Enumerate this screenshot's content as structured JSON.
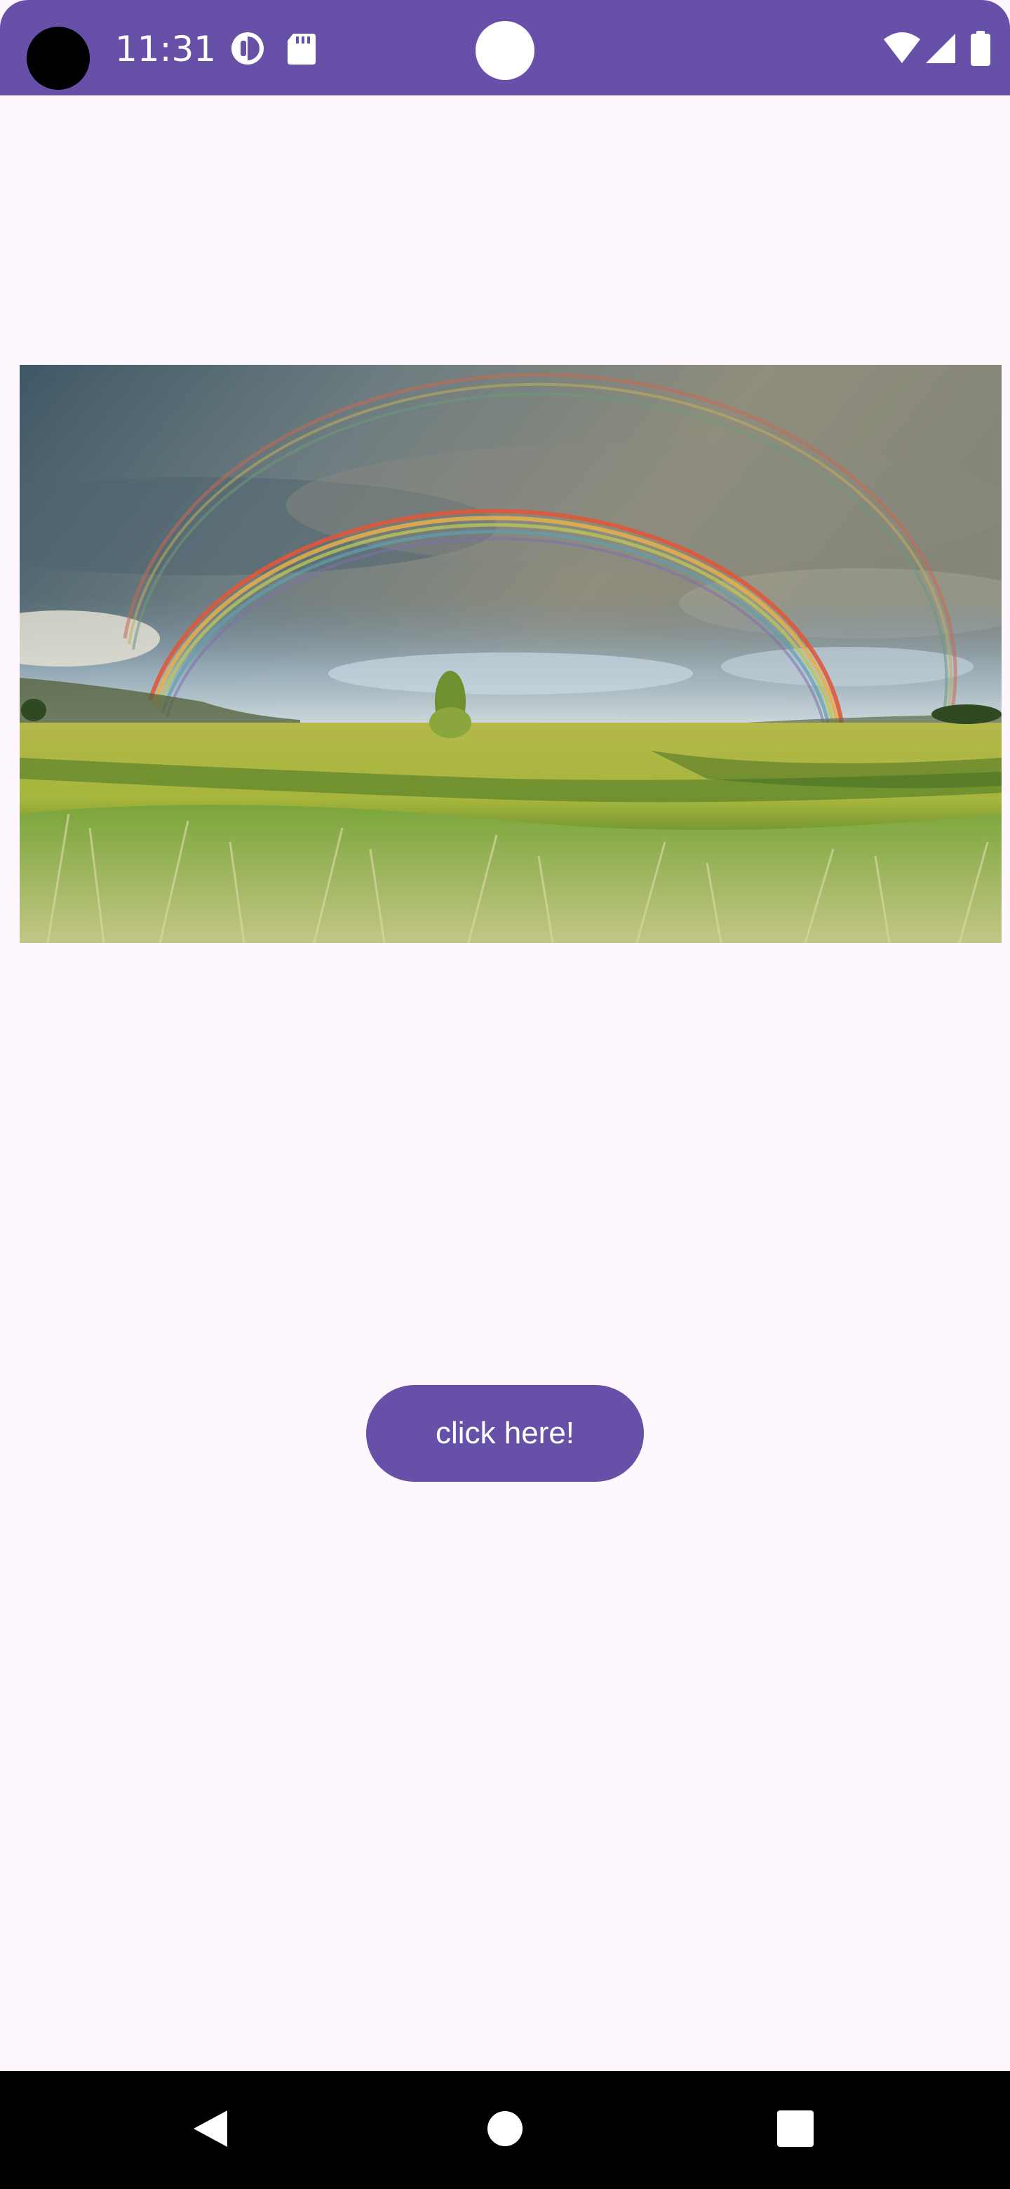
{
  "status_bar": {
    "time": "11:31",
    "left_icons": [
      "privacy-indicator-icon",
      "sd-card-icon"
    ],
    "right_icons": [
      "wifi-icon",
      "cell-signal-icon",
      "battery-icon"
    ]
  },
  "main": {
    "image": {
      "icon": "rainbow-landscape-image"
    },
    "button": {
      "label": "click here!"
    }
  },
  "nav_bar": {
    "buttons": [
      "back-icon",
      "home-icon",
      "recents-icon"
    ]
  },
  "colors": {
    "accent": "#6750a8",
    "background": "#fef7fd",
    "nav": "#000000"
  }
}
